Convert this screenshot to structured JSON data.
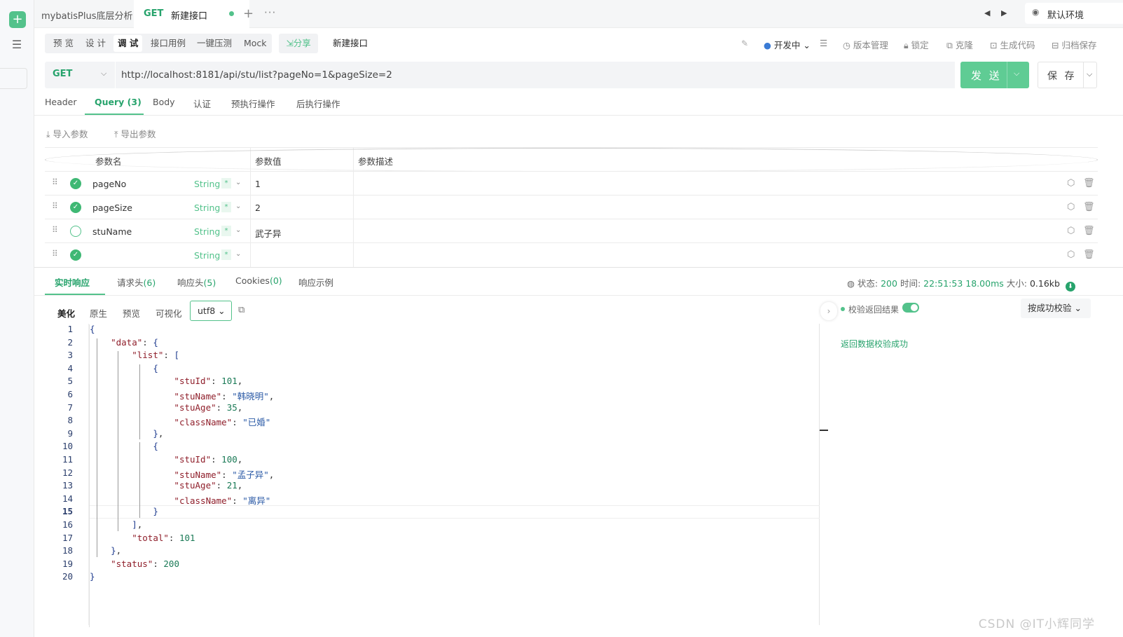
{
  "sidebar": {
    "add_icon": "plus-icon",
    "tree_icon": "tree-toggle-icon"
  },
  "tabbar": {
    "project": "mybatisPlus底层分析",
    "tab": {
      "method": "GET",
      "title": "新建接口"
    },
    "add": "+",
    "more": "···",
    "prev": "◀",
    "next": "▶",
    "environment": "默认环境"
  },
  "mode_tabs": [
    "预 览",
    "设 计",
    "调 试",
    "接口用例",
    "一键压测",
    "Mock"
  ],
  "share_label": "⇲分享",
  "api_name": "新建接口",
  "tools": {
    "status": "开发中",
    "version": "版本管理",
    "lock": "锁定",
    "clone": "克隆",
    "codegen": "生成代码",
    "archive": "归档保存"
  },
  "request": {
    "method": "GET",
    "url": "http://localhost:8181/api/stu/list?pageNo=1&pageSize=2",
    "send_label": "发 送",
    "save_label": "保 存"
  },
  "request_tabs": [
    "Header",
    "Query (3)",
    "Body",
    "认证",
    "预执行操作",
    "后执行操作"
  ],
  "import_label": "导入参数",
  "export_label": "导出参数",
  "params": {
    "headers": {
      "name": "参数名",
      "value": "参数值",
      "desc": "参数描述"
    },
    "rows": [
      {
        "checked": true,
        "name": "pageNo",
        "type": "String",
        "required": "*",
        "value": "1"
      },
      {
        "checked": true,
        "name": "pageSize",
        "type": "String",
        "required": "*",
        "value": "2"
      },
      {
        "checked": false,
        "name": "stuName",
        "type": "String",
        "required": "*",
        "value": "武子异"
      },
      {
        "checked": true,
        "name": "",
        "type": "String",
        "required": "*",
        "value": ""
      }
    ]
  },
  "response_tabs": [
    {
      "label": "实时响应",
      "count": ""
    },
    {
      "label": "请求头",
      "count": "(6)"
    },
    {
      "label": "响应头",
      "count": "(5)"
    },
    {
      "label": "Cookies",
      "count": "(0)"
    },
    {
      "label": "响应示例",
      "count": ""
    }
  ],
  "status_bar": {
    "status_label": "状态:",
    "status": "200",
    "time_label": "时间:",
    "time": "22:51:53",
    "duration": "18.00ms",
    "size_label": "大小:",
    "size": "0.16kb"
  },
  "body_modes": [
    "美化",
    "原生",
    "预览",
    "可视化"
  ],
  "encoding": "utf8",
  "code_lines": [
    "{",
    "    \"data\": {",
    "        \"list\": [",
    "            {",
    "                \"stuId\": 101,",
    "                \"stuName\": \"韩晓明\",",
    "                \"stuAge\": 35,",
    "                \"className\": \"已婚\"",
    "            },",
    "            {",
    "                \"stuId\": 100,",
    "                \"stuName\": \"孟子异\",",
    "                \"stuAge\": 21,",
    "                \"className\": \"离异\"",
    "            }",
    "        ],",
    "        \"total\": 101",
    "    },",
    "    \"status\": 200",
    "}"
  ],
  "highlighted_line": 15,
  "validation": {
    "label": "校验返回结果",
    "enabled": true,
    "mode": "按成功校验",
    "result": "返回数据校验成功"
  },
  "watermark": "CSDN @IT小辉同学"
}
